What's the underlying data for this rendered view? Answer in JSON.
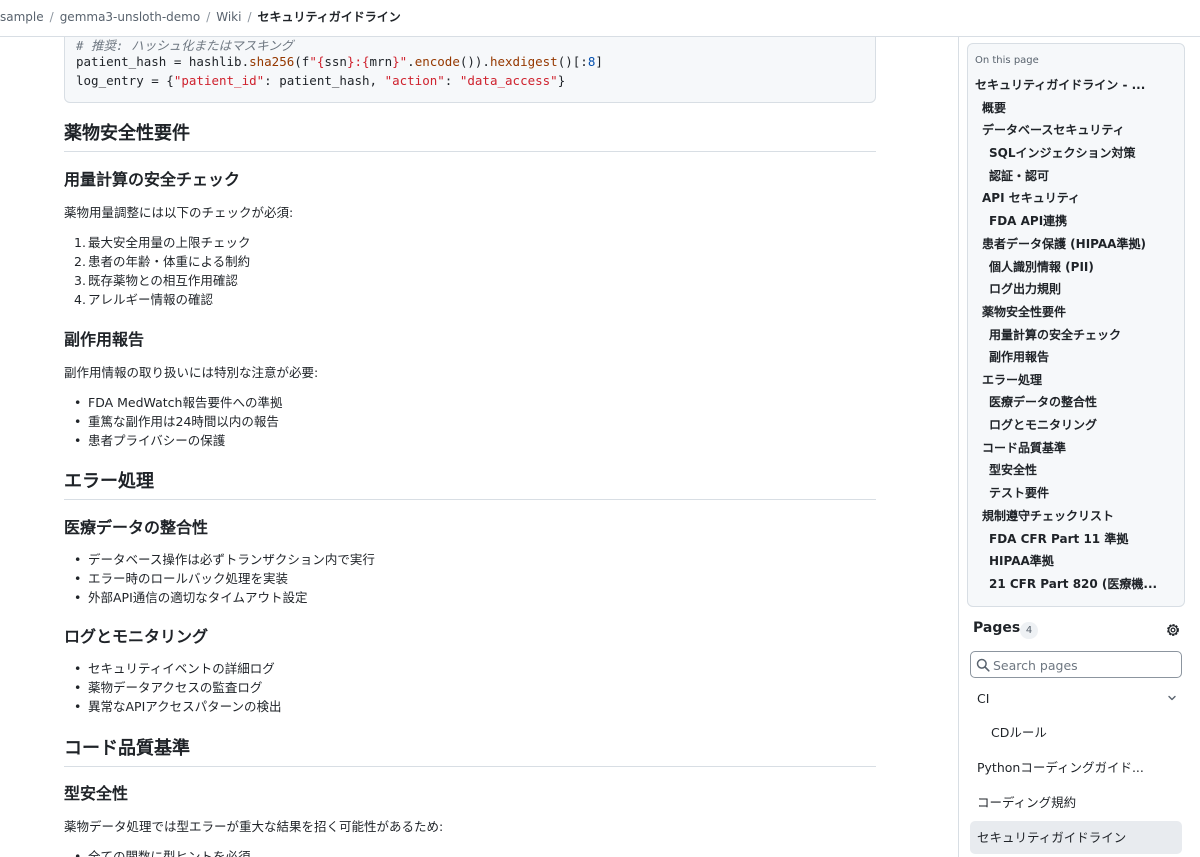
{
  "breadcrumb": {
    "items": [
      "sample",
      "gemma3-unsloth-demo",
      "Wiki"
    ],
    "current": "セキュリティガイドライン",
    "separator": "/"
  },
  "code": {
    "comment": "# 推奨: ハッシュ化またはマスキング",
    "line2": {
      "p1": "patient_hash = hashlib.",
      "fn1": "sha256",
      "p2": "(f",
      "s1": "\"{",
      "v1": "ssn",
      "s2": "}:{",
      "v2": "mrn",
      "s3": "}\"",
      "p3": ".",
      "fn2": "encode",
      "p4": "()).",
      "fn3": "hexdigest",
      "p5": "()[:",
      "num": "8",
      "p6": "]"
    },
    "line3": {
      "p1": "log_entry = {",
      "s1": "\"patient_id\"",
      "p2": ": patient_hash, ",
      "s2": "\"action\"",
      "p3": ": ",
      "s3": "\"data_access\"",
      "p4": "}"
    }
  },
  "content": {
    "h_drug_safety": "薬物安全性要件",
    "h_dose": "用量計算の安全チェック",
    "dose_intro": "薬物用量調整には以下のチェックが必須:",
    "dose_items": [
      "最大安全用量の上限チェック",
      "患者の年齢・体重による制約",
      "既存薬物との相互作用確認",
      "アレルギー情報の確認"
    ],
    "h_side": "副作用報告",
    "side_intro": "副作用情報の取り扱いには特別な注意が必要:",
    "side_items": [
      "FDA MedWatch報告要件への準拠",
      "重篤な副作用は24時間以内の報告",
      "患者プライバシーの保護"
    ],
    "h_error": "エラー処理",
    "h_integrity": "医療データの整合性",
    "integrity_items": [
      "データベース操作は必ずトランザクション内で実行",
      "エラー時のロールバック処理を実装",
      "外部API通信の適切なタイムアウト設定"
    ],
    "h_logging": "ログとモニタリング",
    "logging_items": [
      "セキュリティイベントの詳細ログ",
      "薬物データアクセスの監査ログ",
      "異常なAPIアクセスパターンの検出"
    ],
    "h_quality": "コード品質基準",
    "h_types": "型安全性",
    "types_intro": "薬物データ処理では型エラーが重大な結果を招く可能性があるため:",
    "types_items": [
      "全ての関数に型ヒントを必須"
    ]
  },
  "toc": {
    "heading": "On this page",
    "items": [
      "セキュリティガイドライン - ...",
      "概要",
      "データベースセキュリティ",
      "SQLインジェクション対策",
      "認証・認可",
      "API セキュリティ",
      "FDA API連携",
      "患者データ保護 (HIPAA準拠)",
      "個人識別情報 (PII)",
      "ログ出力規則",
      "薬物安全性要件",
      "用量計算の安全チェック",
      "副作用報告",
      "エラー処理",
      "医療データの整合性",
      "ログとモニタリング",
      "コード品質基準",
      "型安全性",
      "テスト要件",
      "規制遵守チェックリスト",
      "FDA CFR Part 11 準拠",
      "HIPAA準拠",
      "21 CFR Part 820 (医療機..."
    ]
  },
  "pages": {
    "title": "Pages",
    "count": "4",
    "search_placeholder": "Search pages",
    "items": [
      "CI",
      "CDルール",
      "Pythonコーディングガイド...",
      "コーディング規約",
      "セキュリティガイドライン"
    ],
    "active": "セキュリティガイドライン"
  },
  "icons": {
    "gear": "gear-icon",
    "search": "search-icon",
    "chevron": "chevron-down-icon"
  }
}
